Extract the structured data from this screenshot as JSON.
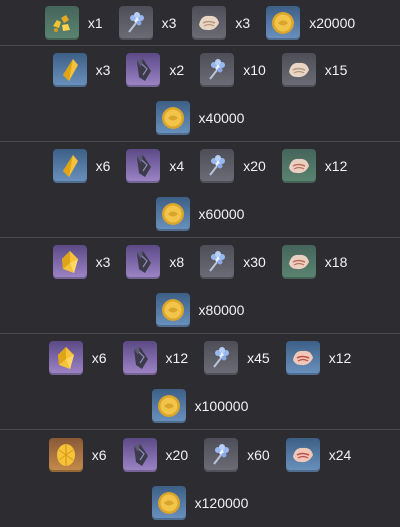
{
  "tiers": [
    {
      "items": [
        {
          "icon": "gold-ore-icon",
          "rarity": "green",
          "qty": "x1"
        },
        {
          "icon": "blue-flower-icon",
          "rarity": "gray",
          "qty": "x3"
        },
        {
          "icon": "shell-icon",
          "rarity": "gray",
          "qty": "x3"
        },
        {
          "icon": "coin-icon",
          "rarity": "blue",
          "qty": "x20000"
        }
      ]
    },
    {
      "items": [
        {
          "icon": "gold-shard-icon",
          "rarity": "blue",
          "qty": "x3"
        },
        {
          "icon": "crystal-chunk-icon",
          "rarity": "purple",
          "qty": "x2"
        },
        {
          "icon": "blue-flower-icon",
          "rarity": "gray",
          "qty": "x10"
        },
        {
          "icon": "shell-icon",
          "rarity": "gray",
          "qty": "x15"
        }
      ],
      "currency": {
        "icon": "coin-icon",
        "rarity": "blue",
        "qty": "x40000"
      }
    },
    {
      "items": [
        {
          "icon": "gold-shard-icon",
          "rarity": "blue",
          "qty": "x6"
        },
        {
          "icon": "crystal-chunk-icon",
          "rarity": "purple",
          "qty": "x4"
        },
        {
          "icon": "blue-flower-icon",
          "rarity": "gray",
          "qty": "x20"
        },
        {
          "icon": "shell-icon",
          "rarity": "green",
          "qty": "x12"
        }
      ],
      "currency": {
        "icon": "coin-icon",
        "rarity": "blue",
        "qty": "x60000"
      }
    },
    {
      "items": [
        {
          "icon": "gold-fragment-icon",
          "rarity": "purple",
          "qty": "x3"
        },
        {
          "icon": "crystal-chunk-icon",
          "rarity": "purple",
          "qty": "x8"
        },
        {
          "icon": "blue-flower-icon",
          "rarity": "gray",
          "qty": "x30"
        },
        {
          "icon": "shell-icon",
          "rarity": "green",
          "qty": "x18"
        }
      ],
      "currency": {
        "icon": "coin-icon",
        "rarity": "blue",
        "qty": "x80000"
      }
    },
    {
      "items": [
        {
          "icon": "gold-fragment-icon",
          "rarity": "purple",
          "qty": "x6"
        },
        {
          "icon": "crystal-chunk-icon",
          "rarity": "purple",
          "qty": "x12"
        },
        {
          "icon": "blue-flower-icon",
          "rarity": "gray",
          "qty": "x45"
        },
        {
          "icon": "shell-icon",
          "rarity": "blue",
          "qty": "x12"
        }
      ],
      "currency": {
        "icon": "coin-icon",
        "rarity": "blue",
        "qty": "x100000"
      }
    },
    {
      "items": [
        {
          "icon": "gold-gem-icon",
          "rarity": "orange",
          "qty": "x6"
        },
        {
          "icon": "crystal-chunk-icon",
          "rarity": "purple",
          "qty": "x20"
        },
        {
          "icon": "blue-flower-icon",
          "rarity": "gray",
          "qty": "x60"
        },
        {
          "icon": "shell-icon",
          "rarity": "blue",
          "qty": "x24"
        }
      ],
      "currency": {
        "icon": "coin-icon",
        "rarity": "blue",
        "qty": "x120000"
      }
    }
  ],
  "colors": {
    "background": "#2d2c31",
    "divider": "#4a494f",
    "text": "#ffffff",
    "rarity_gray": "#6d6d78",
    "rarity_green": "#5c8572",
    "rarity_blue": "#6b93bf",
    "rarity_purple": "#9f86c8",
    "rarity_orange": "#c68c4c"
  }
}
